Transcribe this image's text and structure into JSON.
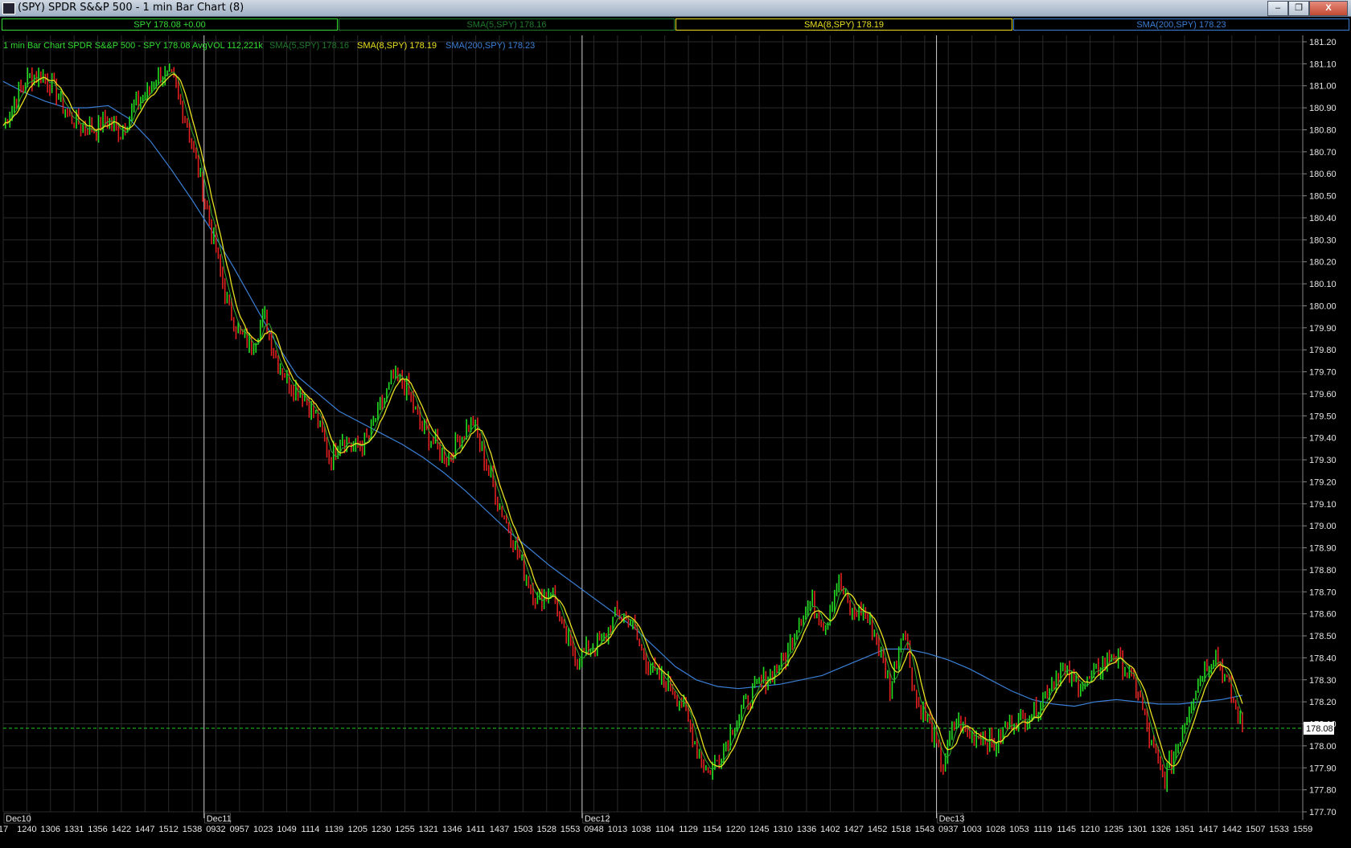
{
  "window": {
    "title": "(SPY) SPDR S&&P 500 - 1 min Bar Chart (8)",
    "minimize_label": "–",
    "restore_label": "❐",
    "close_label": "X"
  },
  "legend_bar": [
    {
      "label": "SPY 178.08 +0.00",
      "color": "#33dd33"
    },
    {
      "label": "SMA(5,SPY) 178.16",
      "color": "#1e7a2a"
    },
    {
      "label": "SMA(8,SPY) 178.19",
      "color": "#e8e020"
    },
    {
      "label": "SMA(200,SPY) 178.23",
      "color": "#3a7fd6"
    }
  ],
  "chart_header": {
    "main": "1 min Bar Chart SPDR S&&P 500 - SPY 178.08 AvgVOL 112,221k",
    "sma5": "SMA(5,SPY) 178.16",
    "sma8": "SMA(8,SPY) 178.19",
    "sma200": "SMA(200,SPY) 178.23"
  },
  "chart_data": {
    "type": "line",
    "symbol": "SPY",
    "last_price": 178.08,
    "last_price_label": "178.08",
    "ylim": [
      177.7,
      181.2
    ],
    "y_ticks": [
      "181.20",
      "181.10",
      "181.00",
      "180.90",
      "180.80",
      "180.70",
      "180.60",
      "180.50",
      "180.40",
      "180.30",
      "180.20",
      "180.10",
      "180.00",
      "179.90",
      "179.80",
      "179.70",
      "179.60",
      "179.50",
      "179.40",
      "179.30",
      "179.20",
      "179.10",
      "179.00",
      "178.90",
      "178.80",
      "178.70",
      "178.60",
      "178.50",
      "178.40",
      "178.30",
      "178.20",
      "178.10",
      "178.00",
      "177.90",
      "177.80",
      "177.70"
    ],
    "x_ticks": [
      "17",
      "1240",
      "1306",
      "1331",
      "1356",
      "1422",
      "1447",
      "1512",
      "1538",
      "0932",
      "0957",
      "1023",
      "1049",
      "1114",
      "1139",
      "1205",
      "1230",
      "1255",
      "1321",
      "1346",
      "1411",
      "1437",
      "1503",
      "1528",
      "1553",
      "0948",
      "1013",
      "1038",
      "1104",
      "1129",
      "1154",
      "1220",
      "1245",
      "1310",
      "1336",
      "1402",
      "1427",
      "1452",
      "1518",
      "1543",
      "0937",
      "1003",
      "1028",
      "1053",
      "1119",
      "1145",
      "1210",
      "1235",
      "1301",
      "1326",
      "1351",
      "1417",
      "1442",
      "1507",
      "1533",
      "1559"
    ],
    "day_labels": [
      "Dec10",
      "Dec11",
      "Dec12",
      "Dec13"
    ],
    "day_separators_at_tick": [
      9,
      25,
      40
    ],
    "grid": true,
    "colors": {
      "up": "#22dd22",
      "down": "#e02020",
      "sma5": "#2faa2f",
      "sma8": "#e8e020",
      "sma200": "#3a7fd6",
      "grid": "#2a2a2a",
      "price_line": "#22cc22"
    },
    "series": [
      {
        "name": "SPY",
        "values": [
          180.82,
          180.95,
          181.04,
          181.05,
          180.98,
          180.86,
          180.82,
          180.8,
          180.85,
          180.79,
          180.9,
          180.96,
          181.06,
          181.02,
          180.85,
          180.6,
          180.34,
          180.05,
          179.88,
          179.82,
          179.95,
          179.75,
          179.65,
          179.6,
          179.5,
          179.3,
          179.41,
          179.35,
          179.4,
          179.55,
          179.68,
          179.62,
          179.45,
          179.38,
          179.3,
          179.4,
          179.48,
          179.28,
          179.1,
          178.95,
          178.78,
          178.65,
          178.72,
          178.5,
          178.4,
          178.45,
          178.48,
          178.6,
          178.58,
          178.42,
          178.32,
          178.28,
          178.2,
          178.02,
          177.88,
          177.95,
          178.1,
          178.2,
          178.28,
          178.34,
          178.4,
          178.58,
          178.65,
          178.55,
          178.75,
          178.6,
          178.62,
          178.48,
          178.25,
          178.55,
          178.2,
          178.1,
          177.9,
          178.12,
          178.05,
          178.05,
          178.0,
          178.1,
          178.12,
          178.15,
          178.25,
          178.35,
          178.3,
          178.28,
          178.35,
          178.42,
          178.35,
          178.25,
          178.0,
          177.85,
          178.0,
          178.2,
          178.35,
          178.42,
          178.25,
          178.08
        ]
      },
      {
        "name": "SMA(200,SPY)",
        "values": [
          181.02,
          180.97,
          180.93,
          180.9,
          180.9,
          180.91,
          180.85,
          180.75,
          180.62,
          180.48,
          180.33,
          180.17,
          180.0,
          179.83,
          179.68,
          179.6,
          179.52,
          179.47,
          179.42,
          179.37,
          179.31,
          179.24,
          179.16,
          179.07,
          178.98,
          178.9,
          178.82,
          178.75,
          178.68,
          178.61,
          178.54,
          178.45,
          178.36,
          178.3,
          178.27,
          178.26,
          178.27,
          178.28,
          178.3,
          178.32,
          178.36,
          178.4,
          178.44,
          178.44,
          178.42,
          178.39,
          178.35,
          178.3,
          178.25,
          178.21,
          178.19,
          178.18,
          178.2,
          178.21,
          178.2,
          178.19,
          178.19,
          178.2,
          178.21,
          178.23
        ]
      }
    ]
  }
}
